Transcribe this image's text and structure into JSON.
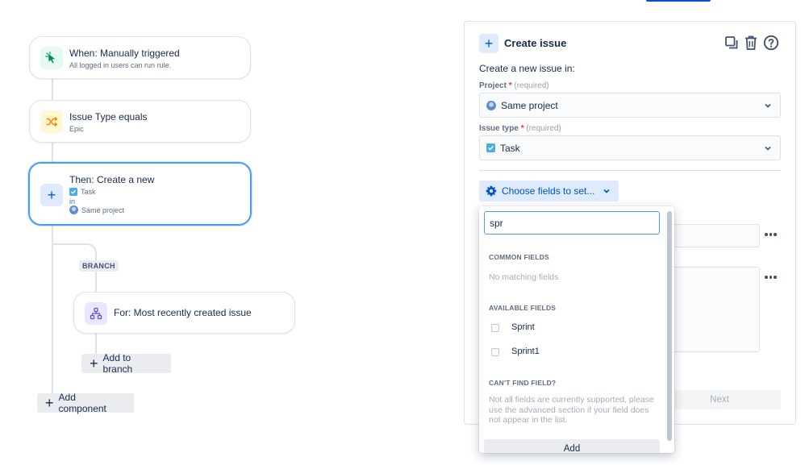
{
  "canvas": {
    "trigger": {
      "title": "When: Manually triggered",
      "subtitle": "All logged in users can run rule."
    },
    "condition": {
      "title": "Issue Type equals",
      "subtitle": "Epic"
    },
    "action": {
      "title": "Then: Create a new",
      "issue_type": "Task",
      "in_label": "in",
      "project": "Same project"
    },
    "branch_tag": "BRANCH",
    "branch_node": {
      "title": "For: Most recently created issue"
    },
    "add_to_branch": "Add to branch",
    "add_component": "Add component"
  },
  "panel": {
    "title": "Create issue",
    "create_in_label": "Create a new issue in:",
    "project": {
      "label": "Project",
      "required_mark": "*",
      "hint": "(required)",
      "value": "Same project"
    },
    "issue_type": {
      "label": "Issue type",
      "required_mark": "*",
      "hint": "(required)",
      "value": "Task"
    },
    "choose_fields": "Choose fields to set...",
    "next_button": "Next"
  },
  "dropdown": {
    "search_value": "spr",
    "common_header": "COMMON FIELDS",
    "no_matching": "No matching fields",
    "available_header": "AVAILABLE FIELDS",
    "options": [
      "Sprint",
      "Sprint1"
    ],
    "cant_find_header": "CAN'T FIND FIELD?",
    "cant_find_text": "Not all fields are currently supported, please use the advanced section if your field does not appear in the list.",
    "add_button": "Add"
  },
  "colors": {
    "accent": "#0052cc",
    "selected_border": "#4c9aff",
    "trigger_bg": "#e3fcef",
    "trigger_icon": "#00875a",
    "condition_bg": "#fff7d6",
    "condition_icon": "#ff8b00",
    "action_bg": "#deebff",
    "branch_bg": "#eae6ff",
    "branch_icon": "#6554c0"
  }
}
